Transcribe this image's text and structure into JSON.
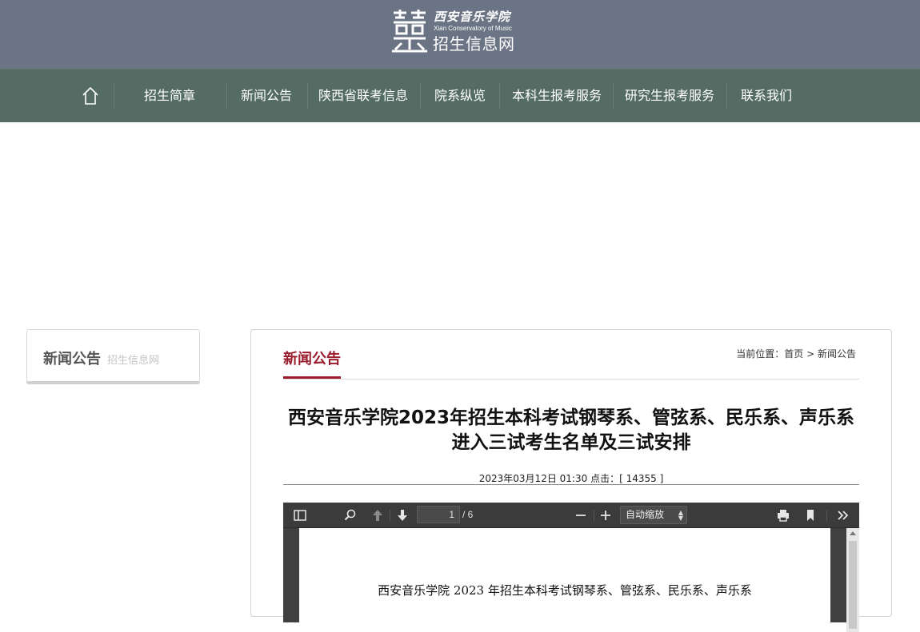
{
  "header": {
    "logo_calligraphy": "西安音乐学院",
    "logo_en": "Xian Conservatory of Music",
    "logo_cn": "招生信息网"
  },
  "nav": {
    "home_icon": "home-icon",
    "items": [
      {
        "label": "招生简章"
      },
      {
        "label": "新闻公告"
      },
      {
        "label": "陕西省联考信息"
      },
      {
        "label": "院系纵览"
      },
      {
        "label": "本科生报考服务"
      },
      {
        "label": "研究生报考服务"
      },
      {
        "label": "联系我们"
      }
    ]
  },
  "sidebar": {
    "title": "新闻公告",
    "subtitle": "招生信息网"
  },
  "main": {
    "section_title": "新闻公告",
    "breadcrumb": {
      "prefix": "当前位置：",
      "home": "首页",
      "separator": ">",
      "current": "新闻公告"
    },
    "article": {
      "title": "西安音乐学院2023年招生本科考试钢琴系、管弦系、民乐系、声乐系进入三试考生名单及三试安排",
      "date": "2023年03月12日 01:30",
      "clicks_label": "点击：",
      "clicks": "[ 14355 ]"
    }
  },
  "pdf_viewer": {
    "page_current": "1",
    "page_total": "/ 6",
    "zoom_label": "自动缩放",
    "page_text": "西安音乐学院 2023 年招生本科考试钢琴系、管弦系、民乐系、声乐系"
  },
  "colors": {
    "header_bg": "#6b7484",
    "nav_bg": "#546c64",
    "accent": "#9a1c2c"
  }
}
